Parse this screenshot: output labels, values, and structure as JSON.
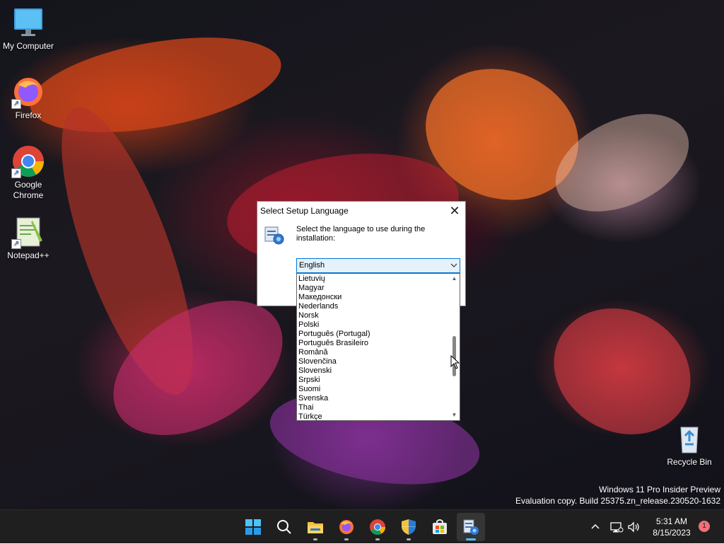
{
  "desktop": {
    "icons": [
      {
        "label": "My Computer",
        "icon": "monitor-icon"
      },
      {
        "label": "Firefox",
        "icon": "firefox-icon"
      },
      {
        "label": "Google Chrome",
        "icon": "chrome-icon"
      },
      {
        "label": "Notepad++",
        "icon": "notepadpp-icon"
      },
      {
        "label": "Recycle Bin",
        "icon": "recycle-bin-icon"
      }
    ],
    "watermark": {
      "line1": "Windows 11 Pro Insider Preview",
      "line2": "Evaluation copy. Build 25375.zn_release.230520-1632"
    }
  },
  "dialog": {
    "title": "Select Setup Language",
    "close_label": "✕",
    "prompt": "Select the language to use during the installation:",
    "selected_language": "English",
    "options": [
      "Lietuvių",
      "Magyar",
      "Македонски",
      "Nederlands",
      "Norsk",
      "Polski",
      "Português (Portugal)",
      "Português Brasileiro",
      "Română",
      "Slovenčina",
      "Slovenski",
      "Srpski",
      "Suomi",
      "Svenska",
      "Thai",
      "Türkçe"
    ]
  },
  "taskbar": {
    "apps": [
      "start-icon",
      "search-icon",
      "file-explorer-icon",
      "firefox-icon",
      "chrome-icon",
      "security-icon",
      "store-icon",
      "setup-icon"
    ],
    "active_app": "setup-icon",
    "clock": {
      "time": "5:31 AM",
      "date": "8/15/2023"
    },
    "notification_count": "1"
  },
  "colors": {
    "accent": "#0078d7",
    "taskbar": "#1f1f1f",
    "combo_bg": "#e5f1fb"
  }
}
